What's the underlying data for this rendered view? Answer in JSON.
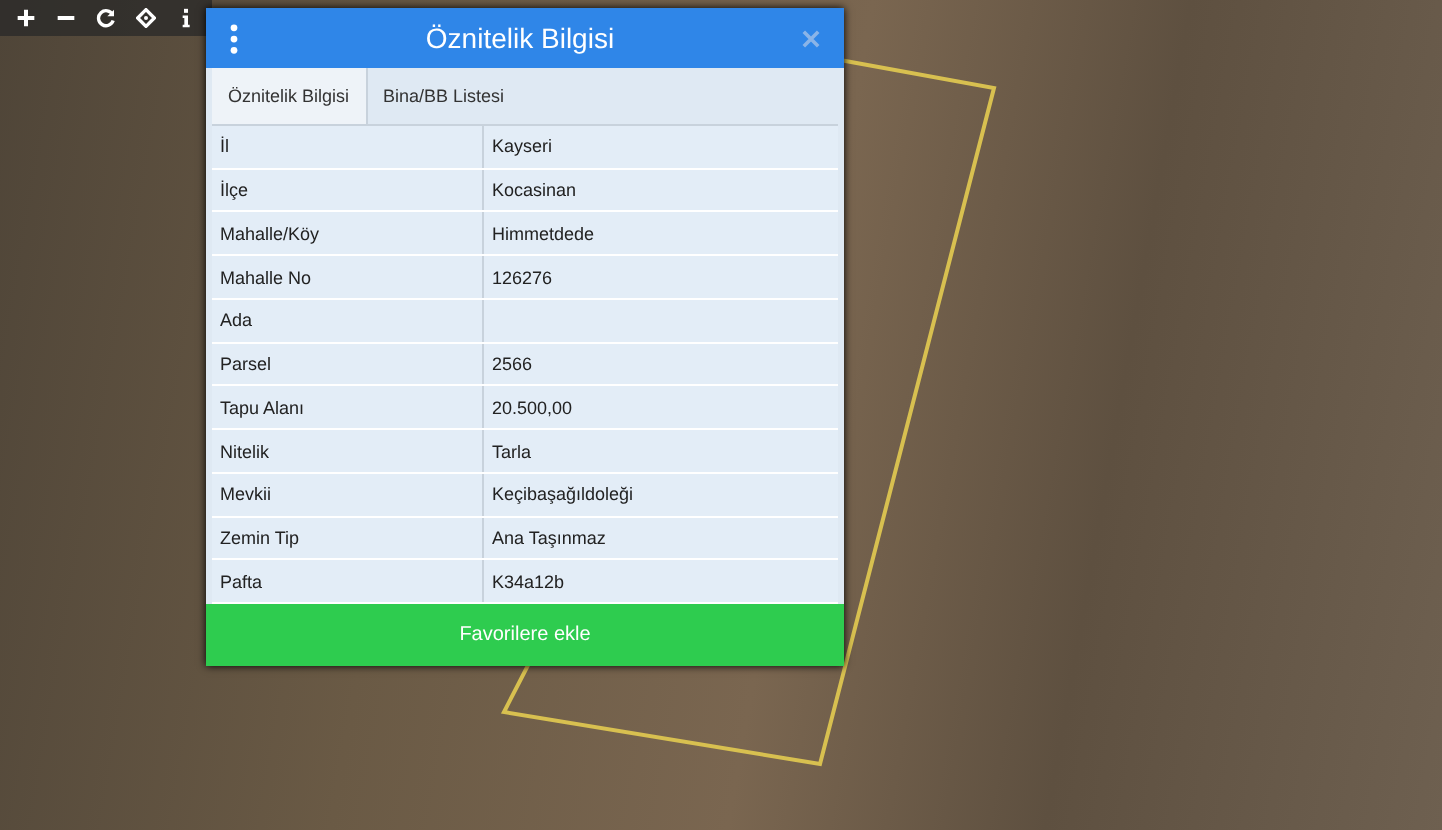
{
  "dialog": {
    "title": "Öznitelik Bilgisi",
    "tabs": [
      {
        "label": "Öznitelik Bilgisi",
        "selected": true
      },
      {
        "label": "Bina/BB Listesi",
        "selected": false
      }
    ],
    "rows": [
      {
        "label": "İl",
        "value": "Kayseri"
      },
      {
        "label": "İlçe",
        "value": "Kocasinan"
      },
      {
        "label": "Mahalle/Köy",
        "value": "Himmetdede"
      },
      {
        "label": "Mahalle No",
        "value": "126276"
      },
      {
        "label": "Ada"
      },
      {
        "label": "Parsel",
        "value": "2566"
      },
      {
        "label": "Tapu Alanı",
        "value": "20.500,00"
      },
      {
        "label": "Nitelik",
        "value": "Tarla"
      },
      {
        "label": "Mevkii",
        "value": "Keçibaşağıldoleği"
      },
      {
        "label": "Zemin Tip",
        "value": "Ana Taşınmaz"
      },
      {
        "label": "Pafta",
        "value": "K34a12b"
      }
    ],
    "button": "Favorilere ekle"
  }
}
